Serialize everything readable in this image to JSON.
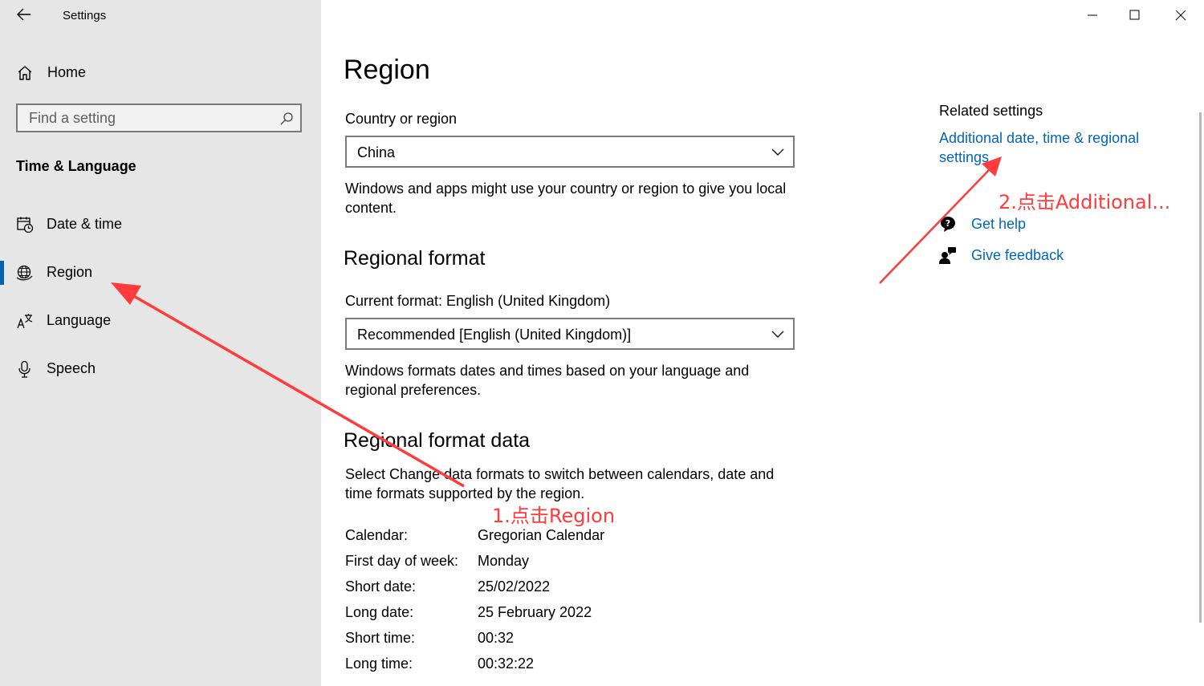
{
  "window": {
    "app_title": "Settings",
    "minimize_icon": "minimize-icon",
    "maximize_icon": "maximize-icon",
    "close_icon": "close-icon"
  },
  "sidebar": {
    "home_label": "Home",
    "search_placeholder": "Find a setting",
    "section_header": "Time & Language",
    "items": [
      {
        "label": "Date & time",
        "icon": "calendar-clock-icon",
        "selected": false
      },
      {
        "label": "Region",
        "icon": "globe-icon",
        "selected": true
      },
      {
        "label": "Language",
        "icon": "language-icon",
        "selected": false
      },
      {
        "label": "Speech",
        "icon": "microphone-icon",
        "selected": false
      }
    ]
  },
  "main": {
    "title": "Region",
    "country_label": "Country or region",
    "country_value": "China",
    "country_desc": "Windows and apps might use your country or region to give you local content.",
    "regional_format_heading": "Regional format",
    "current_format_label": "Current format: English (United Kingdom)",
    "format_value": "Recommended [English (United Kingdom)]",
    "format_desc": "Windows formats dates and times based on your language and regional preferences.",
    "format_data_heading": "Regional format data",
    "format_data_desc": "Select Change data formats to switch between calendars, date and time formats supported by the region.",
    "format_data": [
      {
        "label": "Calendar:",
        "value": "Gregorian Calendar"
      },
      {
        "label": "First day of week:",
        "value": "Monday"
      },
      {
        "label": "Short date:",
        "value": "25/02/2022"
      },
      {
        "label": "Long date:",
        "value": "25 February 2022"
      },
      {
        "label": "Short time:",
        "value": "00:32"
      },
      {
        "label": "Long time:",
        "value": "00:32:22"
      }
    ]
  },
  "related": {
    "title": "Related settings",
    "additional_link": "Additional date, time & regional settings",
    "get_help": "Get help",
    "give_feedback": "Give feedback"
  },
  "annotations": {
    "step1": "1.点击Region",
    "step2": "2.点击Additional...",
    "color": "#ff3b3b"
  },
  "colors": {
    "accent": "#0063b1",
    "link": "#0067b8",
    "sidebar_bg": "#e6e6e6"
  }
}
